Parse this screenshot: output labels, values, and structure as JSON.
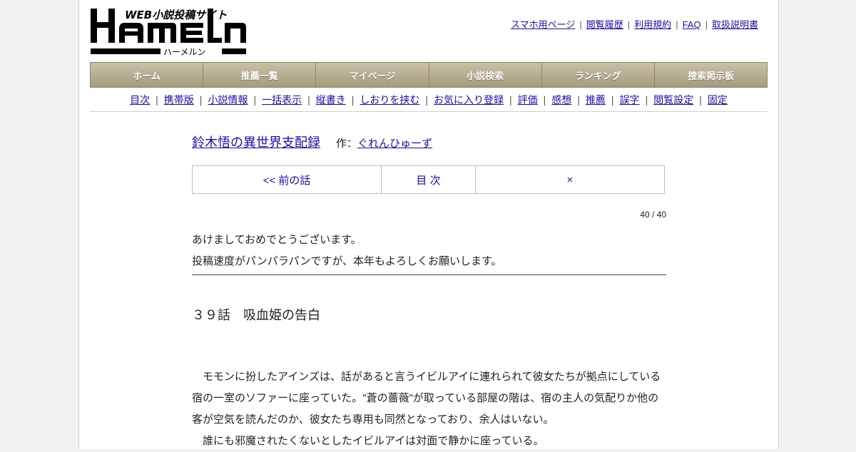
{
  "logo": {
    "wordmark": "HAMELN",
    "tagline": "WEB小説投稿サイト",
    "kana": "ハーメルン"
  },
  "toplinks": [
    "スマホ用ページ",
    "閲覧履歴",
    "利用規約",
    "FAQ",
    "取扱説明書"
  ],
  "mainnav": [
    "ホーム",
    "推薦一覧",
    "マイページ",
    "小説検索",
    "ランキング",
    "捜索掲示板"
  ],
  "subnav": [
    "目次",
    "携帯版",
    "小説情報",
    "一括表示",
    "縦書き",
    "しおりを挟む",
    "お気に入り登録",
    "評価",
    "感想",
    "推薦",
    "誤字",
    "閲覧設定",
    "固定"
  ],
  "novel": {
    "title": "鈴木悟の異世界支配録",
    "author_prefix": "作：",
    "author": "ぐれんひゅーず"
  },
  "pager": {
    "prev": "<< 前の話",
    "toc": "目 次",
    "next": "×"
  },
  "pagecount": "40 / 40",
  "preface": [
    "あけましておめでとうございます。",
    "投稿速度がパンパラパンですが、本年もよろしくお願いします。"
  ],
  "chapter_title": "３９話　吸血姫の告白",
  "body": [
    "　モモンに扮したアインズは、話があると言うイビルアイに連れられて彼女たちが拠点にしている",
    "宿の一室のソファーに座っていた。\"蒼の薔薇\"が取っている部屋の階は、宿の主人の気配りか他の",
    "客が空気を読んだのか、彼女たち専用も同然となっており、余人はいない。",
    "　誰にも邪魔されたくないとしたイビルアイは対面で静かに座っている。"
  ]
}
